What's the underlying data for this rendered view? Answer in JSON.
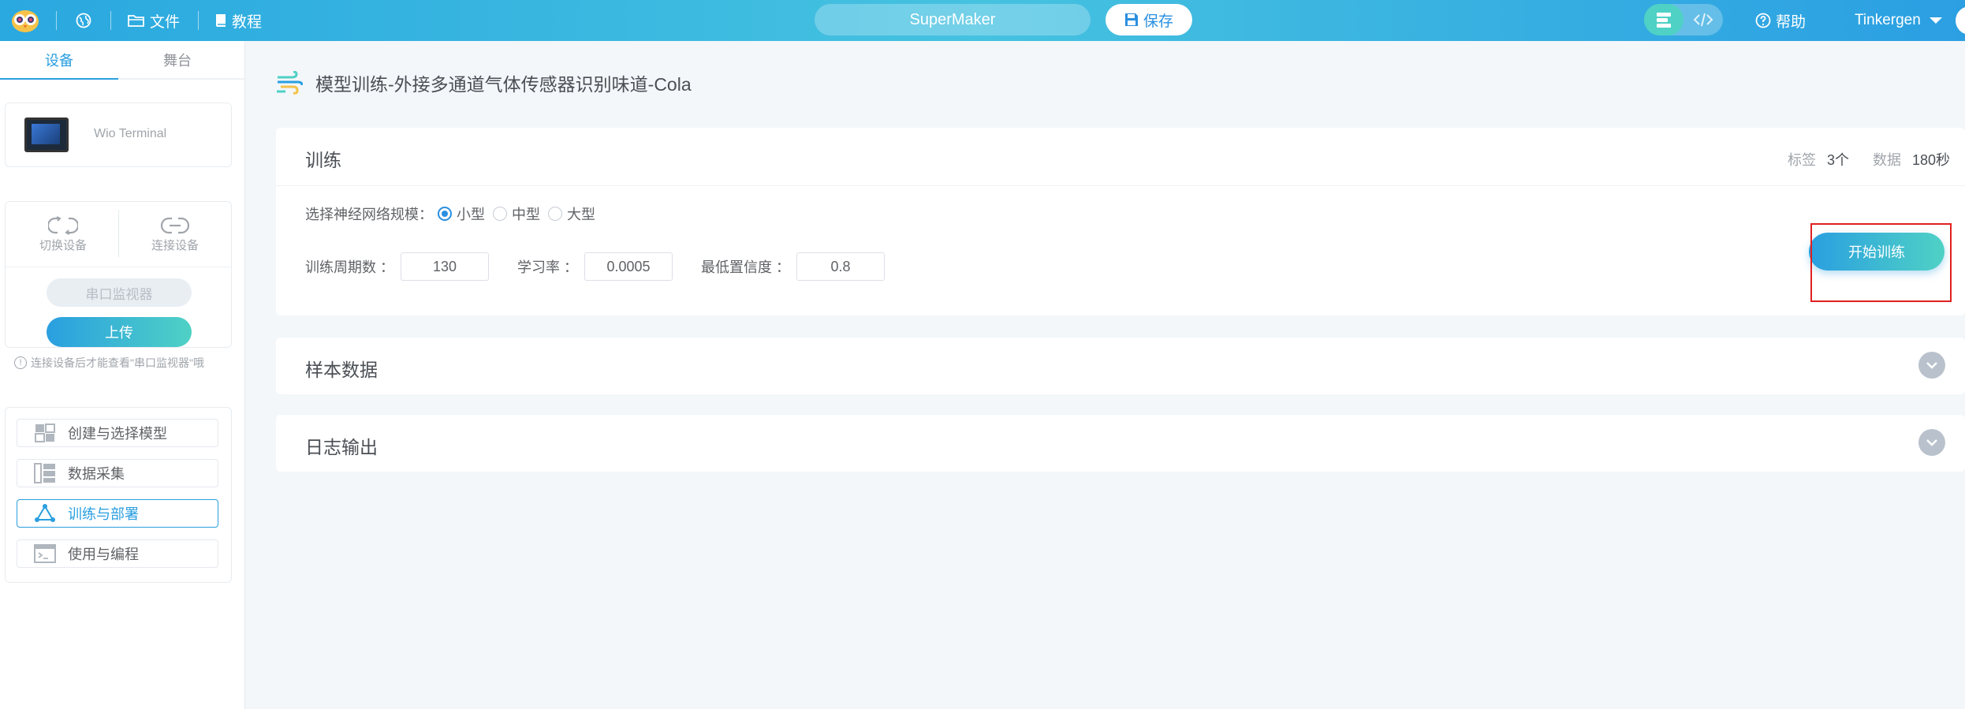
{
  "topbar": {
    "file_label": "文件",
    "tutorial_label": "教程",
    "project_name": "SuperMaker",
    "save_label": "保存",
    "help_label": "帮助",
    "username": "Tinkergen"
  },
  "left": {
    "tabs": [
      "设备",
      "舞台"
    ],
    "active_tab": "设备",
    "device_name": "Wio Terminal",
    "switch_device_label": "切换设备",
    "connect_device_label": "连接设备",
    "serial_monitor_label": "串口监视器",
    "upload_label": "上传",
    "tip": "连接设备后才能查看\"串口监视器\"哦",
    "steps": [
      {
        "label": "创建与选择模型",
        "icon": "grid-icon"
      },
      {
        "label": "数据采集",
        "icon": "data-collect-icon"
      },
      {
        "label": "训练与部署",
        "icon": "network-icon",
        "active": true
      },
      {
        "label": "使用与编程",
        "icon": "code-window-icon"
      }
    ]
  },
  "main": {
    "title": "模型训练-外接多通道气体传感器识别味道-Cola",
    "train": {
      "title": "训练",
      "labels_key": "标签",
      "labels_value": "3个",
      "data_key": "数据",
      "data_value": "180秒",
      "network_scale_label": "选择神经网络规模：",
      "scales": [
        "小型",
        "中型",
        "大型"
      ],
      "selected_scale": "小型",
      "epochs_label": "训练周期数 ：",
      "epochs_value": "130",
      "lr_label": "学习率 ：",
      "lr_value": "0.0005",
      "min_conf_label": "最低置信度 ：",
      "min_conf_value": "0.8",
      "start_label": "开始训练"
    },
    "samples_title": "样本数据",
    "log_title": "日志输出"
  },
  "colors": {
    "accent": "#2a9fe0",
    "teal": "#4fd1c5",
    "highlight_box": "#e02020"
  }
}
